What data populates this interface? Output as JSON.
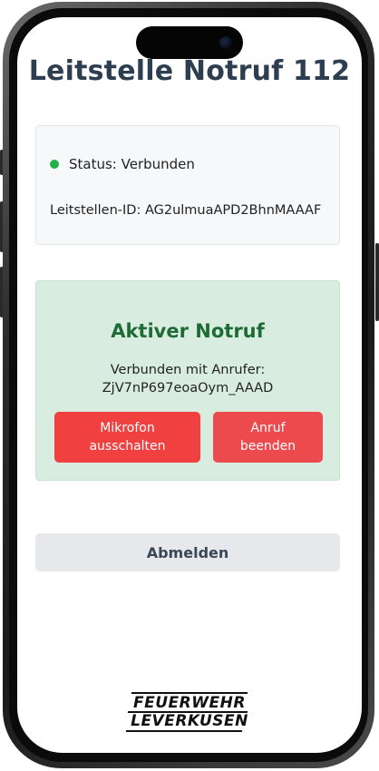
{
  "app": {
    "title": "Leitstelle Notruf 112"
  },
  "status": {
    "text": "Status: Verbunden",
    "indicator_color": "#22b04b",
    "id_text": "Leitstellen-ID: AG2ulmuaAPD2BhnMAAAF"
  },
  "call": {
    "title": "Aktiver Notruf",
    "line1": "Verbunden mit Anrufer:",
    "line2": "ZjV7nP697eoaOym_AAAD",
    "mute_button_line1": "Mikrofon",
    "mute_button_line2": "ausschalten",
    "end_button_line1": "Anruf",
    "end_button_line2": "beenden"
  },
  "logout_label": "Abmelden",
  "logo": {
    "line1": "FEUERWEHR",
    "line2": "LEVERKUSEN"
  },
  "colors": {
    "title": "#2d3e50",
    "call_card_bg": "#d8ede0",
    "call_title": "#1e6b35",
    "danger": "#f0403f",
    "logout_bg": "#e7e8ec"
  },
  "icons": {
    "status_dot": "status-dot-icon",
    "camera": "front-camera-icon"
  }
}
